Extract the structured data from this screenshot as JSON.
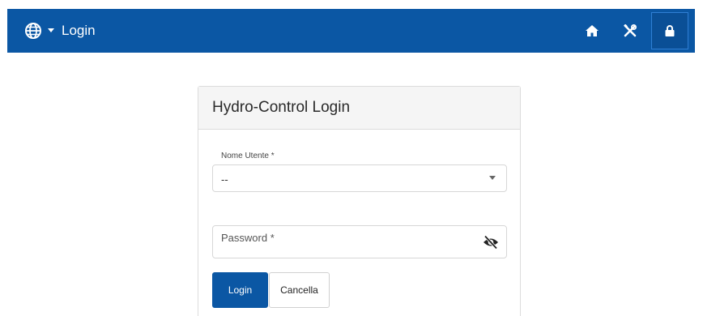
{
  "navbar": {
    "title": "Login",
    "language_icon": "globe-icon",
    "buttons": [
      {
        "icon": "home-icon"
      },
      {
        "icon": "tools-icon"
      },
      {
        "icon": "lock-icon"
      }
    ],
    "color": "#0b57a4"
  },
  "login_card": {
    "title": "Hydro-Control Login",
    "username": {
      "label": "Nome Utente *",
      "value": "--"
    },
    "password": {
      "label": "Password *",
      "toggle_icon": "eye-slash-icon"
    },
    "login_button": "Login",
    "cancel_button": "Cancella"
  }
}
